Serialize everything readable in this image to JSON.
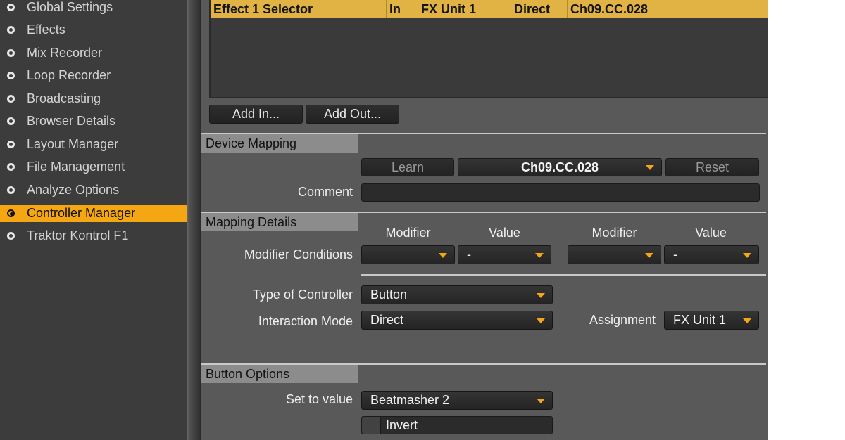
{
  "sidebar": {
    "items": [
      {
        "label": "Global Settings"
      },
      {
        "label": "Effects"
      },
      {
        "label": "Mix Recorder"
      },
      {
        "label": "Loop Recorder"
      },
      {
        "label": "Broadcasting"
      },
      {
        "label": "Browser Details"
      },
      {
        "label": "Layout Manager"
      },
      {
        "label": "File Management"
      },
      {
        "label": "Analyze Options"
      },
      {
        "label": "Controller Manager",
        "active": true
      },
      {
        "label": "Traktor Kontrol F1"
      }
    ]
  },
  "assignment_table": {
    "rows": [
      {
        "control": "Effect 1 Selector",
        "io": "In",
        "assignment": "FX Unit 1",
        "mode": "Direct",
        "mapped_to": "Ch09.CC.028"
      }
    ]
  },
  "table_buttons": {
    "add_in": "Add In...",
    "add_out": "Add Out..."
  },
  "device_mapping": {
    "header": "Device Mapping",
    "learn": "Learn",
    "mapped_value": "Ch09.CC.028",
    "reset": "Reset",
    "comment_label": "Comment",
    "comment_value": ""
  },
  "mapping_details": {
    "header": "Mapping Details",
    "col_modifier_1": "Modifier",
    "col_value_1": "Value",
    "col_modifier_2": "Modifier",
    "col_value_2": "Value",
    "conditions_label": "Modifier Conditions",
    "cond1_modifier": "",
    "cond1_value": "-",
    "cond2_modifier": "",
    "cond2_value": "-",
    "controller_type_label": "Type of Controller",
    "controller_type": "Button",
    "interaction_mode_label": "Interaction Mode",
    "interaction_mode": "Direct",
    "assignment_label": "Assignment",
    "assignment": "FX Unit 1"
  },
  "button_options": {
    "header": "Button Options",
    "set_to_value_label": "Set to value",
    "set_to_value": "Beatmasher 2",
    "invert_label": "Invert"
  },
  "colors": {
    "accent": "#f5a613",
    "row_highlight": "#e1b244",
    "panel": "#595959",
    "sidebar": "#3c3c3c"
  }
}
